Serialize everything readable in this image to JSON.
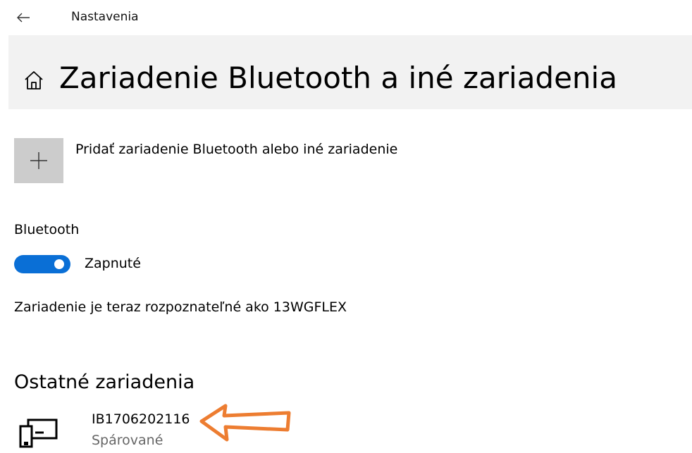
{
  "titlebar": {
    "back_icon": "back-arrow-icon",
    "app_title": "Nastavenia"
  },
  "header": {
    "icon": "home-icon",
    "title": "Zariadenie Bluetooth a iné zariadenia"
  },
  "add_device": {
    "icon": "plus-icon",
    "label": "Pridať zariadenie Bluetooth alebo iné zariadenie"
  },
  "bluetooth": {
    "heading": "Bluetooth",
    "toggle_state": "on",
    "toggle_label": "Zapnuté",
    "discoverable_text": "Zariadenie je teraz rozpoznateľné ako 13WGFLEX"
  },
  "other_devices": {
    "heading": "Ostatné zariadenia",
    "items": [
      {
        "icon": "device-icon",
        "name": "IB1706202116",
        "status": "Spárované"
      }
    ]
  },
  "annotation": {
    "icon": "arrow-annotation",
    "color": "#ed7d31"
  },
  "colors": {
    "accent": "#0a6fd6",
    "header_bg": "#f2f2f2",
    "add_button_bg": "#cccccc",
    "secondary_text": "#666666"
  }
}
